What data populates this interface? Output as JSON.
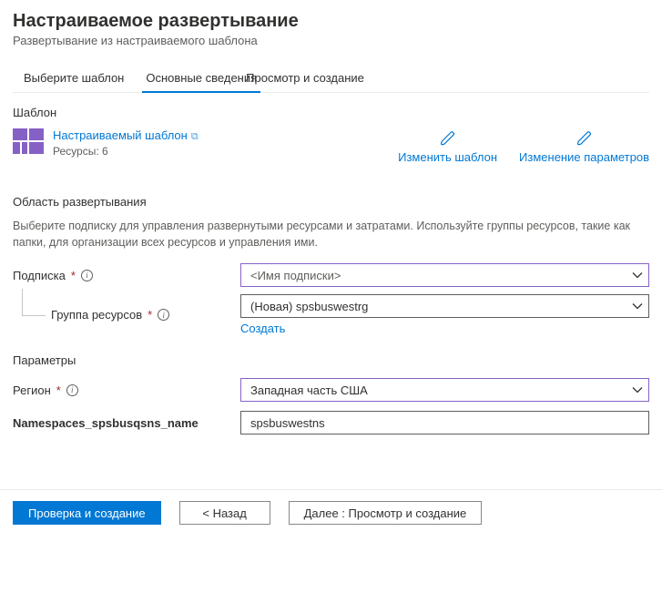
{
  "header": {
    "title": "Настраиваемое развертывание",
    "subtitle": "Развертывание из настраиваемого шаблона"
  },
  "tabs": {
    "t1": "Выберите шаблон",
    "t2": "Основные сведения",
    "t3": "Просмотр и создание"
  },
  "template": {
    "section": "Шаблон",
    "name": "Настраиваемый шаблон",
    "resources": "Ресурсы: 6",
    "edit_template": "Изменить шаблон",
    "edit_params": "Изменение параметров"
  },
  "scope": {
    "section": "Область развертывания",
    "desc": "Выберите подписку для управления развернутыми ресурсами и затратами. Используйте группы ресурсов, такие как папки, для организации всех ресурсов и управления ими.",
    "subscription_label": "Подписка",
    "subscription_value": "<Имя подписки>",
    "rg_label": "Группа ресурсов",
    "rg_value": "(Новая) spsbuswestrg",
    "create_new": "Создать"
  },
  "params": {
    "section": "Параметры",
    "region_label": "Регион",
    "region_value": "Западная часть США",
    "ns_label": "Namespaces_spsbusqsns_name",
    "ns_value": "spsbuswestns"
  },
  "footer": {
    "review": "Проверка и  создание",
    "back": "<  Назад",
    "next": "Далее :  Просмотр и   создание"
  }
}
